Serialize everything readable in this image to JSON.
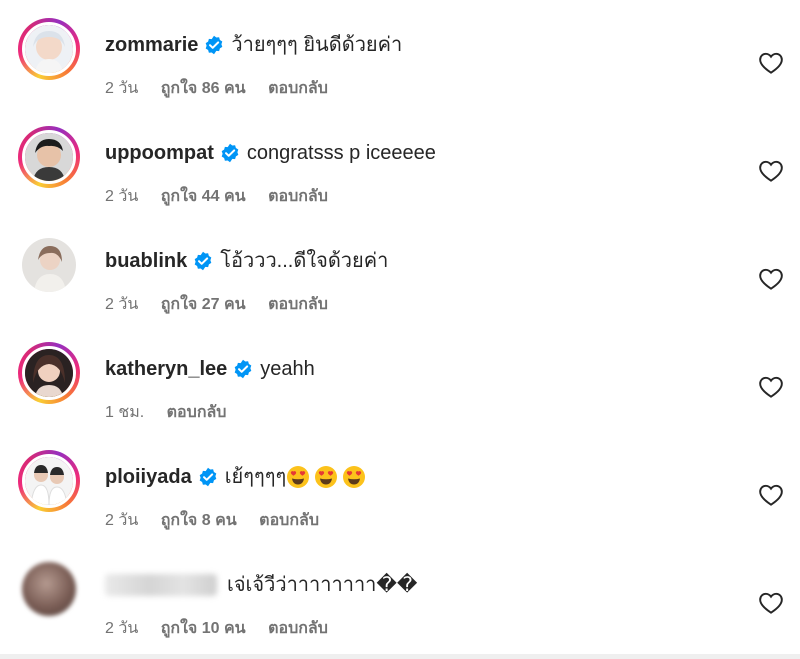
{
  "comments": [
    {
      "username": "zommarie",
      "verified": true,
      "text": "ว้ายๆๆๆ ยินดีด้วยค่า",
      "time": "2 วัน",
      "likes": "ถูกใจ 86 คน",
      "reply": "ตอบกลับ",
      "avatar_icon": "profile-photo-zommarie"
    },
    {
      "username": "uppoompat",
      "verified": true,
      "text": "congratsss p iceeeee",
      "time": "2 วัน",
      "likes": "ถูกใจ 44 คน",
      "reply": "ตอบกลับ",
      "avatar_icon": "profile-photo-uppoompat"
    },
    {
      "username": "buablink",
      "verified": true,
      "text": "โอ้ววว...ดีใจด้วยค่า",
      "time": "2 วัน",
      "likes": "ถูกใจ 27 คน",
      "reply": "ตอบกลับ",
      "avatar_icon": "profile-photo-buablink"
    },
    {
      "username": "katheryn_lee",
      "verified": true,
      "text": "yeahh",
      "time": "1 ชม.",
      "likes": "",
      "reply": "ตอบกลับ",
      "avatar_icon": "profile-photo-katheryn_lee"
    },
    {
      "username": "ploiiyada",
      "verified": true,
      "text": "เย้ๆๆๆๆ",
      "emoji": [
        "heart-eyes-emoji",
        "heart-eyes-emoji",
        "heart-eyes-emoji"
      ],
      "time": "2 วัน",
      "likes": "ถูกใจ 8 คน",
      "reply": "ตอบกลับ",
      "avatar_icon": "profile-photo-ploiiyada"
    },
    {
      "username": "",
      "verified": false,
      "text": "เจ่เจ้วีว่าาาาาาาา��",
      "time": "2 วัน",
      "likes": "ถูกใจ 10 คน",
      "reply": "ตอบกลับ",
      "avatar_icon": "blurred-profile-photo"
    }
  ],
  "colors": {
    "verified_blue": "#0095f6",
    "meta_gray": "#737373",
    "text_dark": "#262626",
    "story_ring": [
      "#f9ce34",
      "#ee2a7b",
      "#962fbf"
    ]
  },
  "icons": {
    "like": "heart-outline-icon",
    "verified": "verified-badge-icon"
  }
}
